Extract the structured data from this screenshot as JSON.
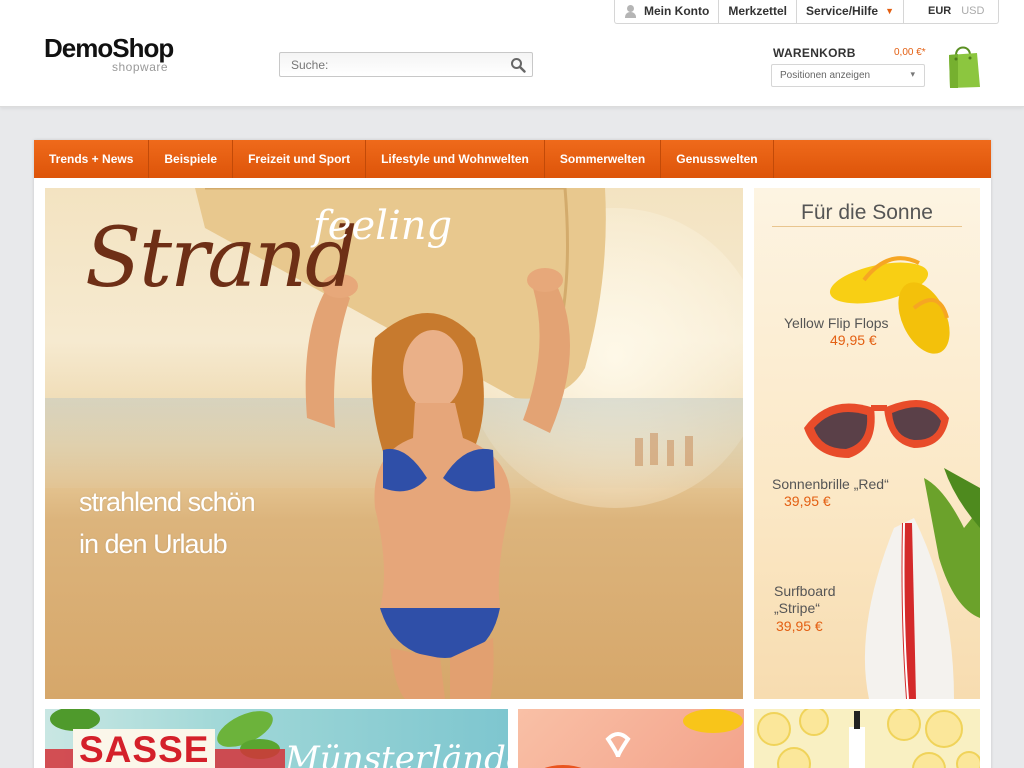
{
  "topbar": {
    "account": "Mein Konto",
    "wishlist": "Merkzettel",
    "service": "Service/Hilfe",
    "currencies": [
      "EUR",
      "USD"
    ],
    "active_currency": "EUR"
  },
  "logo": {
    "main": "DemoShop",
    "sub": "shopware"
  },
  "search": {
    "placeholder": "Suche:"
  },
  "cart": {
    "label": "WARENKORB",
    "amount": "0,00 €*",
    "select_label": "Positionen anzeigen"
  },
  "nav": {
    "items": [
      "Trends + News",
      "Beispiele",
      "Freizeit und Sport",
      "Lifestyle und Wohnwelten",
      "Sommerwelten",
      "Genusswelten"
    ]
  },
  "hero": {
    "script_main": "Strand",
    "script_secondary": "feeling",
    "tagline_line1": "strahlend schön",
    "tagline_line2": "in den Urlaub"
  },
  "side_banner": {
    "title": "Für die Sonne",
    "products": [
      {
        "name": "Yellow Flip Flops",
        "price": "49,95 €"
      },
      {
        "name": "Sonnenbrille „Red“",
        "price": "39,95 €"
      },
      {
        "name_line1": "Surfboard",
        "name_line2": "„Stripe“",
        "price": "39,95 €"
      }
    ]
  },
  "teasers": {
    "first_brand": "SASSE",
    "first_headline": "Münsterländer"
  },
  "colors": {
    "accent": "#e35f12",
    "nav_bg": "#e85f12",
    "bag": "#8cc63f"
  }
}
